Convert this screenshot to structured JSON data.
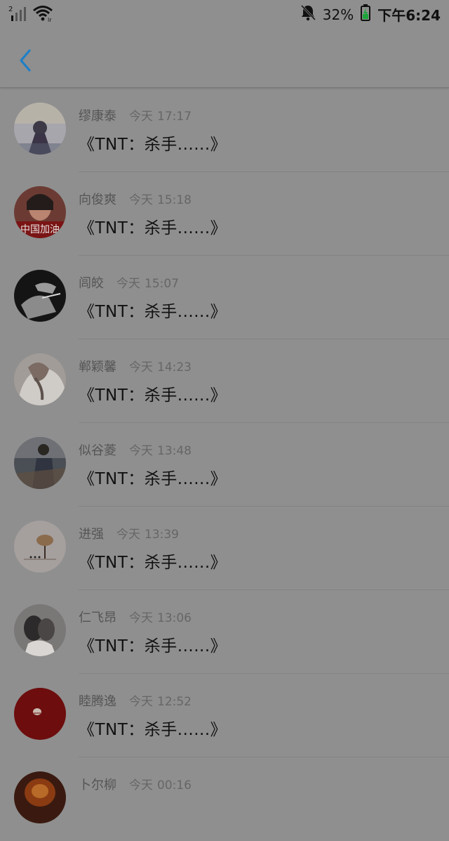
{
  "status_bar": {
    "sim": "2",
    "network_badge": "lr",
    "battery": "32%",
    "time": "下午6:24"
  },
  "header": {
    "back_icon": "chevron-left-icon",
    "accent_color": "#1e7fc8"
  },
  "items": [
    {
      "name": "缪康泰",
      "day": "今天",
      "time": "17:17",
      "title": "《TNT：杀手......》"
    },
    {
      "name": "向俊爽",
      "day": "今天",
      "time": "15:18",
      "title": "《TNT：杀手......》",
      "avatar_caption": "中国加油"
    },
    {
      "name": "闾皎",
      "day": "今天",
      "time": "15:07",
      "title": "《TNT：杀手......》"
    },
    {
      "name": "郸颖馨",
      "day": "今天",
      "time": "14:23",
      "title": "《TNT：杀手......》"
    },
    {
      "name": "似谷菱",
      "day": "今天",
      "time": "13:48",
      "title": "《TNT：杀手......》"
    },
    {
      "name": "进强",
      "day": "今天",
      "time": "13:39",
      "title": "《TNT：杀手......》"
    },
    {
      "name": "仁飞昂",
      "day": "今天",
      "time": "13:06",
      "title": "《TNT：杀手......》"
    },
    {
      "name": "睦腾逸",
      "day": "今天",
      "time": "12:52",
      "title": "《TNT：杀手......》"
    },
    {
      "name": "卜尔柳",
      "day": "今天",
      "time": "00:16",
      "title": ""
    }
  ]
}
